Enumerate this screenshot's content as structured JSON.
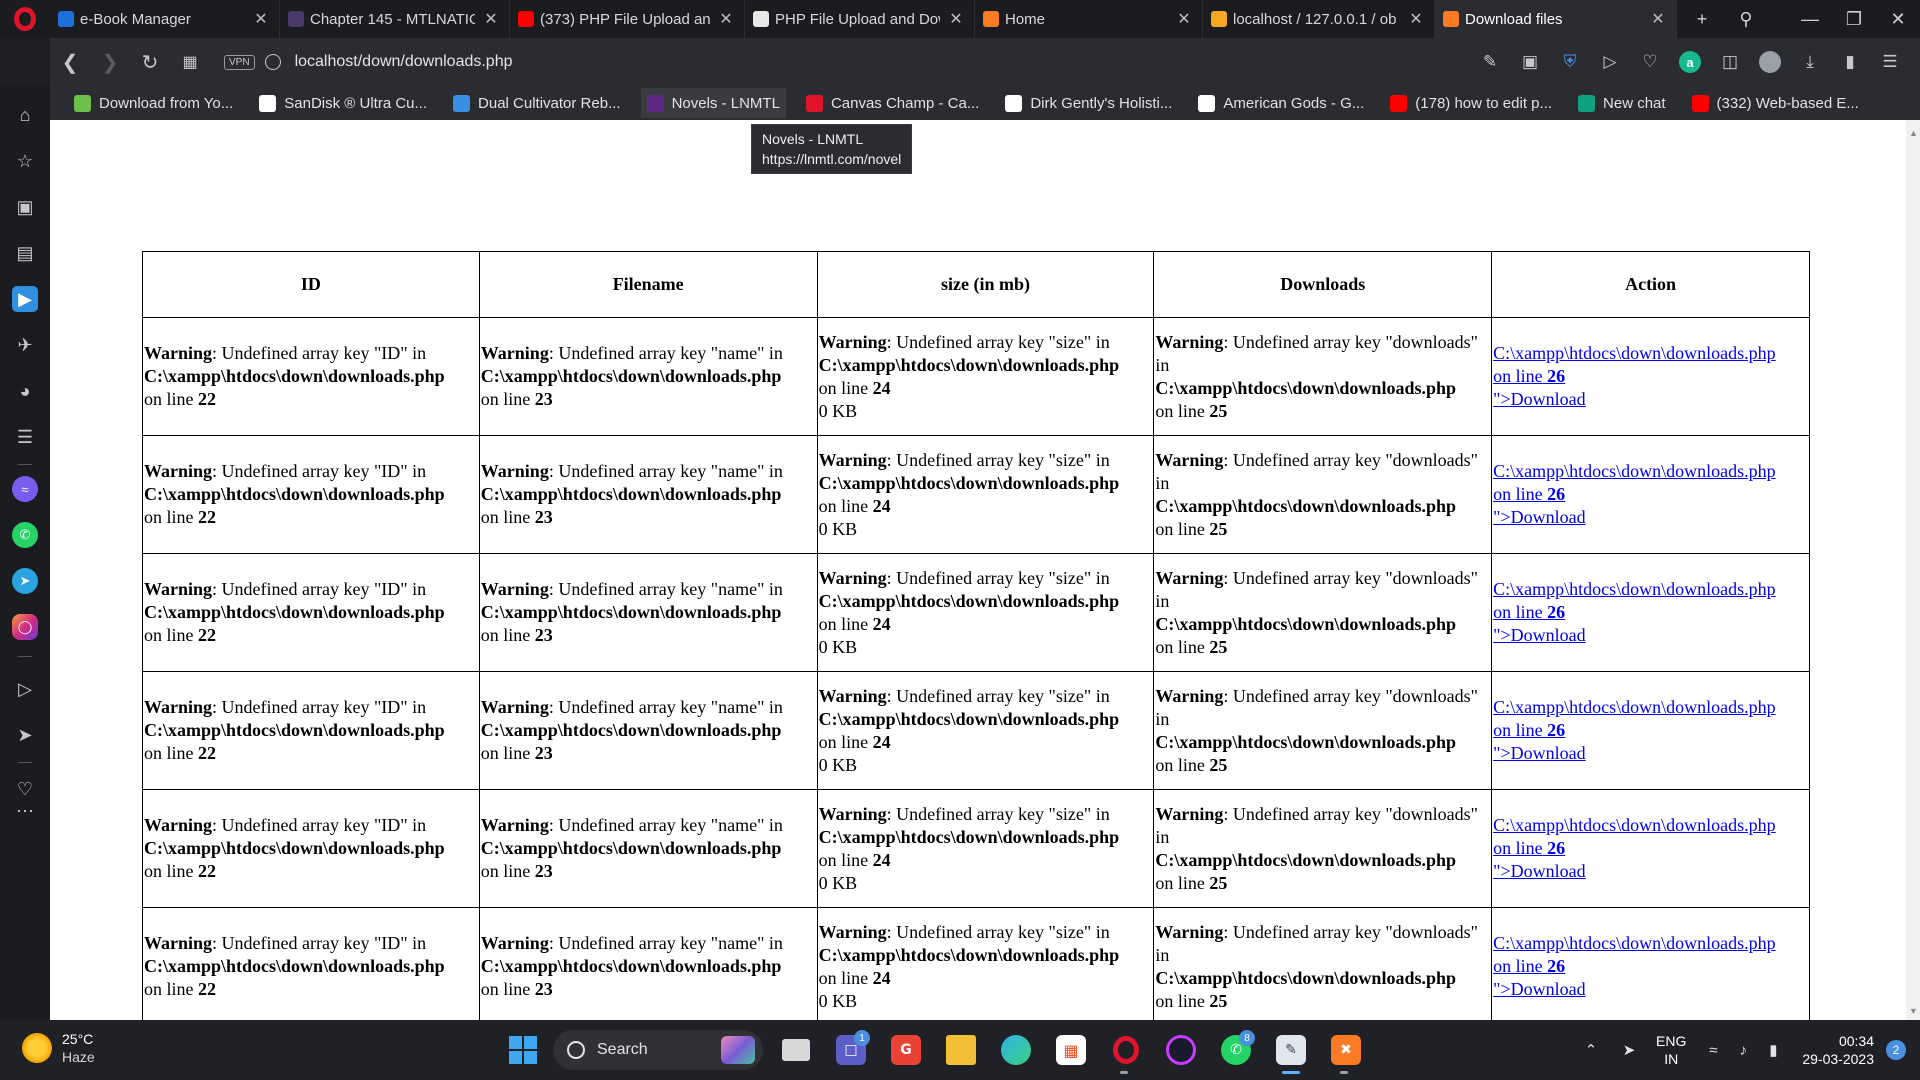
{
  "tabs": [
    {
      "title": "e-Book Manager",
      "favicon": "ebook-icon",
      "active": false
    },
    {
      "title": "Chapter 145 - MTLNATION",
      "favicon": "mtl-icon",
      "active": false
    },
    {
      "title": "(373) PHP File Upload and",
      "favicon": "youtube-icon",
      "active": false
    },
    {
      "title": "PHP File Upload and Dow",
      "favicon": "github-icon",
      "active": false
    },
    {
      "title": "Home",
      "favicon": "xampp-icon",
      "active": false
    },
    {
      "title": "localhost / 127.0.0.1 / ob",
      "favicon": "phpmyadmin-icon",
      "active": false
    },
    {
      "title": "Download files",
      "favicon": "xampp-icon",
      "active": true
    }
  ],
  "address_bar": {
    "vpn_label": "VPN",
    "url_host": "localhost",
    "url_path": "/down/downloads.php"
  },
  "bookmarks": [
    {
      "label": "Download from Yo...",
      "favicon": "download-arrow-icon",
      "color": "#6cc04a"
    },
    {
      "label": "SanDisk ® Ultra Cu...",
      "favicon": "amazon-icon",
      "color": "#ffffff"
    },
    {
      "label": "Dual Cultivator Reb...",
      "favicon": "book-icon",
      "color": "#3b8fe0"
    },
    {
      "label": "Novels - LNMTL",
      "favicon": "lnmtl-icon",
      "color": "#5a2a82"
    },
    {
      "label": "Canvas Champ - Ca...",
      "favicon": "canvas-icon",
      "color": "#e0142a"
    },
    {
      "label": "Dirk Gently's Holisti...",
      "favicon": "google-icon",
      "color": "#ffffff"
    },
    {
      "label": "American Gods - G...",
      "favicon": "google-icon",
      "color": "#ffffff"
    },
    {
      "label": "(178) how to edit p...",
      "favicon": "youtube-icon",
      "color": "#ff0000"
    },
    {
      "label": "New chat",
      "favicon": "openai-icon",
      "color": "#10a37f"
    },
    {
      "label": "(332) Web-based E...",
      "favicon": "youtube-icon",
      "color": "#ff0000"
    }
  ],
  "tooltip": {
    "title": "Novels - LNMTL",
    "url": "https://lnmtl.com/novel"
  },
  "table": {
    "headers": [
      "ID",
      "Filename",
      "size (in mb)",
      "Downloads",
      "Action"
    ],
    "row": {
      "warning_word": "Warning",
      "id_msg": ": Undefined array key \"ID\" in",
      "name_msg": ": Undefined array key \"name\" in",
      "size_msg": ": Undefined array key \"size\" in",
      "downloads_msg": ": Undefined array key \"downloads\" in",
      "path": "C:\\xampp\\htdocs\\down\\downloads.php",
      "on_line": "on line",
      "line_id": "22",
      "line_name": "23",
      "line_size": "24",
      "line_downloads": "25",
      "line_action": "26",
      "size_suffix": "0 KB",
      "action_link_prefix": "C:\\xampp\\htdocs\\down\\downloads.php",
      "action_link_suffix": "\">Download"
    },
    "row_count": 6
  },
  "taskbar": {
    "weather_temp": "25°C",
    "weather_cond": "Haze",
    "search_label": "Search",
    "teams_badge": "1",
    "whatsapp_badge": "8",
    "lang_top": "ENG",
    "lang_bottom": "IN",
    "time": "00:34",
    "date": "29-03-2023",
    "notification_count": "2"
  }
}
